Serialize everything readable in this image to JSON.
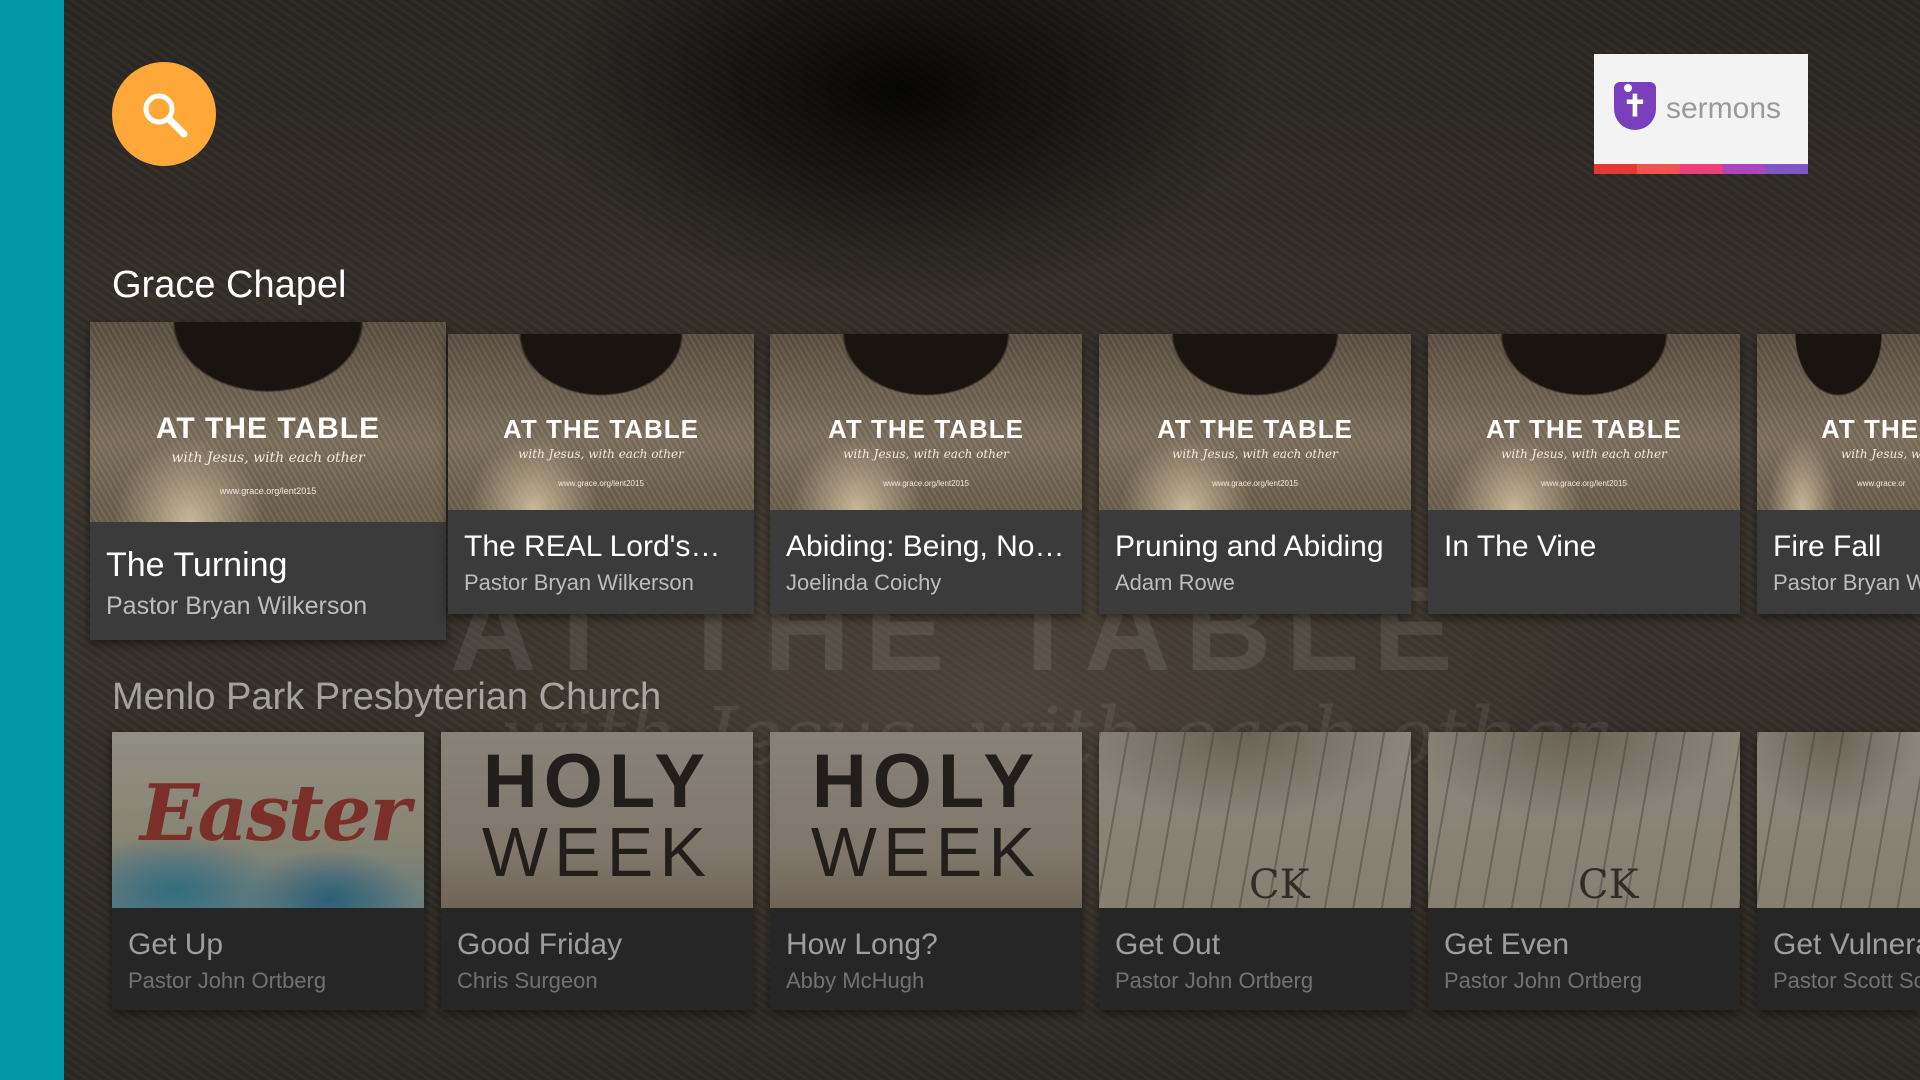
{
  "app": {
    "logo_text": "sermons",
    "logo_mark": "✝",
    "colors": {
      "rail": "#0097a7",
      "search": "#ffa83a",
      "logo_purple": "#7b3fbd"
    }
  },
  "search": {
    "icon": "search-icon"
  },
  "rows": [
    {
      "title": "Grace Chapel",
      "items": [
        {
          "title": "The Turning",
          "speaker": "Pastor Bryan Wilkerson",
          "art": {
            "line1": "AT THE TABLE",
            "line2": "with Jesus, with each other",
            "line3": "www.grace.org/lent2015"
          }
        },
        {
          "title": "The REAL Lord's…",
          "speaker": "Pastor Bryan Wilkerson",
          "art": {
            "line1": "AT THE TABLE",
            "line2": "with Jesus, with each other",
            "line3": "www.grace.org/lent2015"
          }
        },
        {
          "title": "Abiding: Being, Not…",
          "speaker": "Joelinda Coichy",
          "art": {
            "line1": "AT THE TABLE",
            "line2": "with Jesus, with each other",
            "line3": "www.grace.org/lent2015"
          }
        },
        {
          "title": "Pruning and Abiding",
          "speaker": "Adam Rowe",
          "art": {
            "line1": "AT THE TABLE",
            "line2": "with Jesus, with each other",
            "line3": "www.grace.org/lent2015"
          }
        },
        {
          "title": "In The Vine",
          "speaker": "",
          "art": {
            "line1": "AT THE TABLE",
            "line2": "with Jesus, with each other",
            "line3": "www.grace.org/lent2015"
          }
        },
        {
          "title": "Fire Fall",
          "speaker": "Pastor Bryan W",
          "art": {
            "line1": "AT THE",
            "line2": "with Jesus, wit",
            "line3": "www.grace.or"
          }
        }
      ]
    },
    {
      "title": "Menlo Park Presbyterian Church",
      "items": [
        {
          "title": "Get Up",
          "speaker": "Pastor John Ortberg",
          "art": {
            "text": "Easter"
          }
        },
        {
          "title": "Good Friday",
          "speaker": "Chris Surgeon",
          "art": {
            "line1": "HOLY",
            "line2": "WEEK"
          }
        },
        {
          "title": "How Long?",
          "speaker": "Abby McHugh",
          "art": {
            "line1": "HOLY",
            "line2": "WEEK"
          }
        },
        {
          "title": "Get Out",
          "speaker": "Pastor John Ortberg",
          "art": {
            "text": "CK"
          }
        },
        {
          "title": "Get Even",
          "speaker": "Pastor John Ortberg",
          "art": {
            "text": "CK"
          }
        },
        {
          "title": "Get Vulnerab",
          "speaker": "Pastor Scott Sc",
          "art": {
            "text": ""
          }
        }
      ]
    }
  ],
  "background": {
    "headline": "AT THE TABLE",
    "tagline": "with Jesus, with each other"
  }
}
